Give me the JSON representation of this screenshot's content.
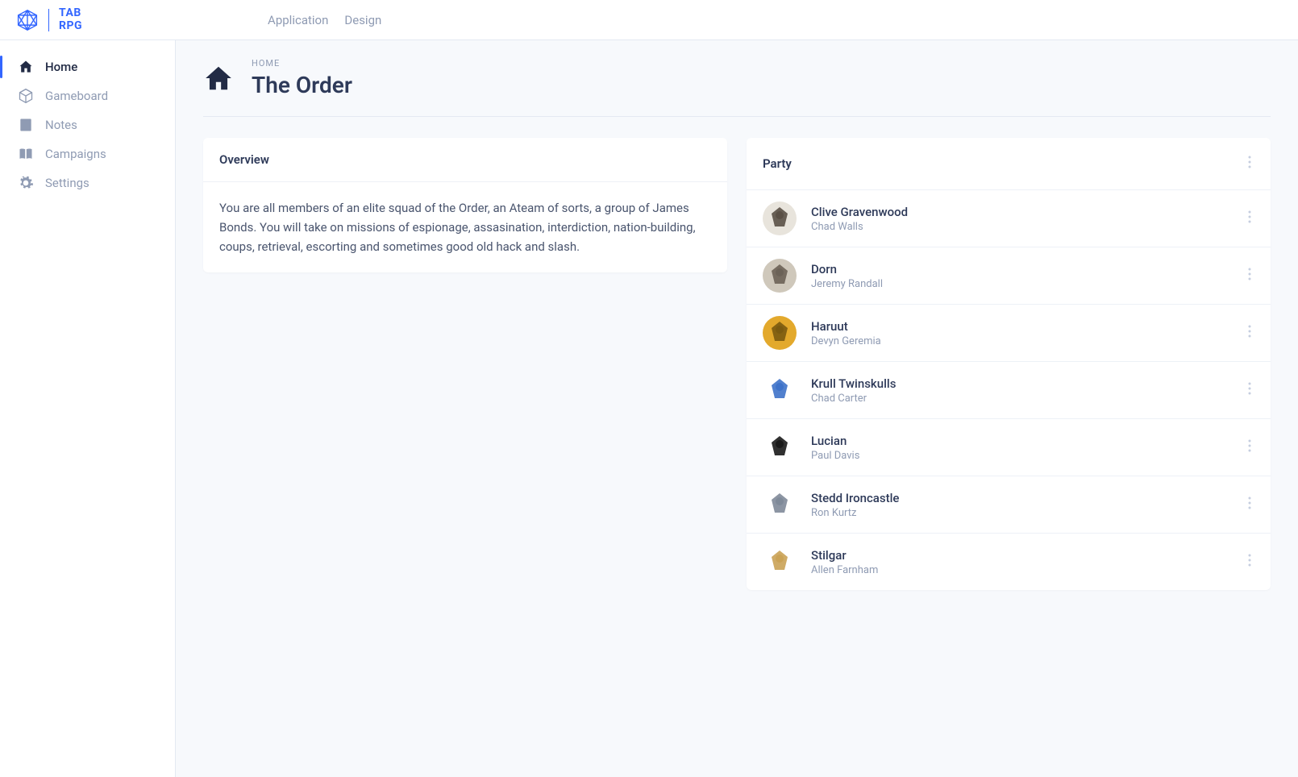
{
  "brand": {
    "line1": "TAB",
    "line2": "RPG"
  },
  "topnav": [
    {
      "label": "Application"
    },
    {
      "label": "Design"
    }
  ],
  "sidebar": {
    "items": [
      {
        "label": "Home",
        "icon": "home",
        "active": true
      },
      {
        "label": "Gameboard",
        "icon": "dice",
        "active": false
      },
      {
        "label": "Notes",
        "icon": "note",
        "active": false
      },
      {
        "label": "Campaigns",
        "icon": "book",
        "active": false
      },
      {
        "label": "Settings",
        "icon": "gear",
        "active": false
      }
    ]
  },
  "breadcrumb": "HOME",
  "page_title": "The Order",
  "overview": {
    "title": "Overview",
    "body": "You are all members of an elite squad of the Order, an Ateam of sorts, a group of James Bonds. You will take on missions of espionage, assasination, interdiction, nation-building, coups, retrieval, escorting and sometimes good old hack and slash."
  },
  "party": {
    "title": "Party",
    "members": [
      {
        "name": "Clive Gravenwood",
        "player": "Chad Walls",
        "avatar_bg": "#e8e4dc",
        "avatar_fg": "#5a5046"
      },
      {
        "name": "Dorn",
        "player": "Jeremy Randall",
        "avatar_bg": "#cfc8bb",
        "avatar_fg": "#6b6257"
      },
      {
        "name": "Haruut",
        "player": "Devyn Geremia",
        "avatar_bg": "#e3a92c",
        "avatar_fg": "#7a5a10"
      },
      {
        "name": "Krull Twinskulls",
        "player": "Chad Carter",
        "avatar_bg": "#ffffff",
        "avatar_fg": "#3e72c9"
      },
      {
        "name": "Lucian",
        "player": "Paul Davis",
        "avatar_bg": "#ffffff",
        "avatar_fg": "#1a1a1a"
      },
      {
        "name": "Stedd Ironcastle",
        "player": "Ron Kurtz",
        "avatar_bg": "#ffffff",
        "avatar_fg": "#7f8a99"
      },
      {
        "name": "Stilgar",
        "player": "Allen Farnham",
        "avatar_bg": "#ffffff",
        "avatar_fg": "#caa255"
      }
    ]
  }
}
